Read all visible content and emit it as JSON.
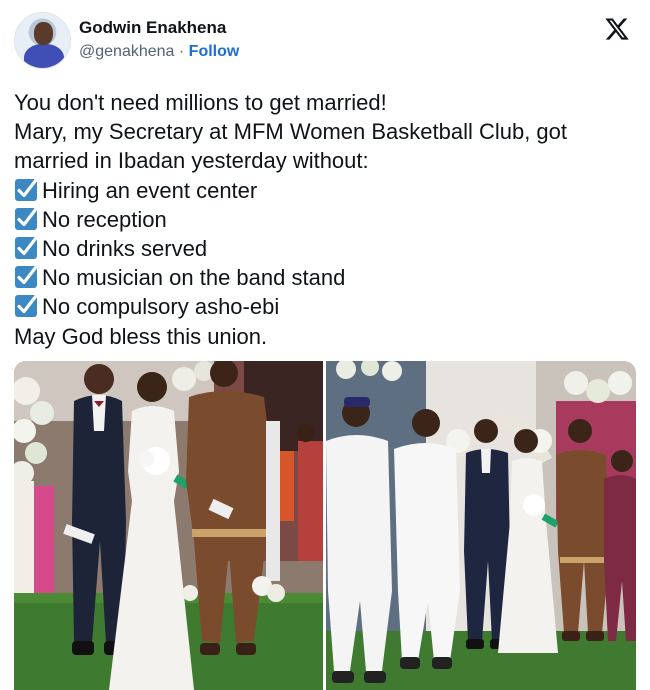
{
  "author": {
    "name": "Godwin Enakhena",
    "handle": "@genakhena",
    "separator": "·",
    "follow_label": "Follow"
  },
  "icons": {
    "platform": "x-logo-icon",
    "check": "check-box-icon"
  },
  "tweet": {
    "line1": "You don't need millions to get married!",
    "line2": "Mary, my Secretary at MFM Women Basketball Club, got",
    "line3": "married in Ibadan yesterday without:",
    "checklist": [
      "Hiring an event center",
      "No reception",
      "No drinks served",
      "No musician on the band stand",
      "No compulsory asho-ebi"
    ],
    "closing": "May God bless this union."
  },
  "colors": {
    "text": "#0f1419",
    "muted": "#536471",
    "link": "#1d6fd0",
    "check_box": "#3b88c3"
  }
}
